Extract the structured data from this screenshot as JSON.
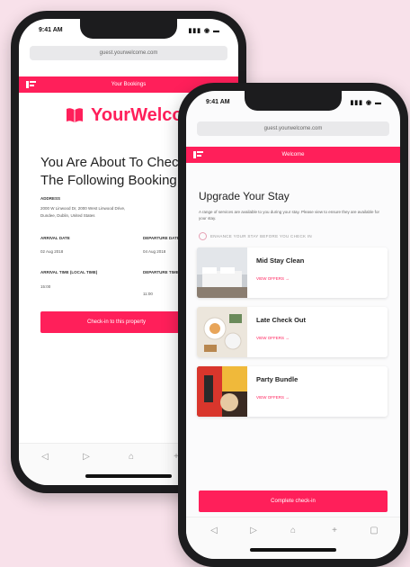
{
  "back": {
    "status_time": "9:41 AM",
    "signal": "▮▮▮ ◉ ▬",
    "url": "guest.yourwelcome.com",
    "bar_title": "Your Bookings",
    "logo_text": "YourWelcome",
    "heading_line1": "You Are About To Check-In",
    "heading_line2": "The Following Booking:",
    "address_label": "ADDRESS",
    "address_line1": "2000 W Linwood Dr, 2000 West Linwood Drive,",
    "address_line2": "Dundee, Dublin, United States",
    "arrival_label": "ARRIVAL DATE",
    "arrival_value": "02 Aug 2018",
    "departure_label": "DEPARTURE DATE",
    "departure_value": "04 Aug 2018",
    "arrival_time_label": "ARRIVAL TIME (LOCAL TIME)",
    "arrival_time_value": "15:00",
    "departure_time_label": "DEPARTURE TIME",
    "departure_time_value": "11:00",
    "cta_label": "Check-in to this property",
    "nav_icons": [
      "◁",
      "▷",
      "⌂",
      "+",
      "▢"
    ]
  },
  "front": {
    "status_time": "9:41 AM",
    "signal": "▮▮▮ ◉ ▬",
    "url": "guest.yourwelcome.com",
    "bar_title": "Welcome",
    "title": "Upgrade Your Stay",
    "intro": "A range of services are available to you during your stay. Please view to ensure they are available for your stay.",
    "section_label": "ENHANCE YOUR STAY BEFORE YOU CHECK IN",
    "cards": [
      {
        "name": "Mid Stay Clean",
        "link": "VIEW OFFERS →"
      },
      {
        "name": "Late Check Out",
        "link": "VIEW OFFERS →"
      },
      {
        "name": "Party Bundle",
        "link": "VIEW OFFERS →"
      }
    ],
    "checkin_label": "Complete check-in",
    "nav_icons": [
      "◁",
      "▷",
      "⌂",
      "+",
      "▢"
    ]
  },
  "colors": {
    "accent": "#ff1f5a",
    "background": "#f8e1ea"
  }
}
